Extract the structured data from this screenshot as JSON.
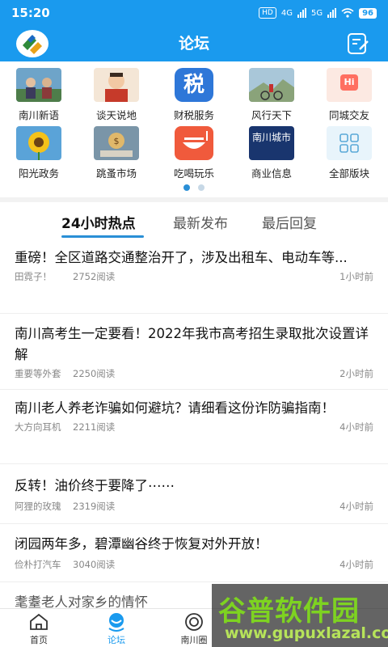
{
  "status_bar": {
    "time": "15:20",
    "hd": "HD",
    "net1": "4G",
    "net2": "5G",
    "battery": "96"
  },
  "header": {
    "title": "论坛",
    "logo_icon": "app-logo-icon",
    "compose_icon": "compose-icon"
  },
  "categories": [
    {
      "label": "南川新语",
      "icon": "news-photo"
    },
    {
      "label": "谈天说地",
      "icon": "chat-photo"
    },
    {
      "label": "财税服务",
      "icon": "tax-icon",
      "icon_text": "税"
    },
    {
      "label": "风行天下",
      "icon": "cycling-photo"
    },
    {
      "label": "同城交友",
      "icon": "map-hi-icon",
      "icon_text": "Hi"
    },
    {
      "label": "阳光政务",
      "icon": "sunflower-photo"
    },
    {
      "label": "跳蚤市场",
      "icon": "market-photo"
    },
    {
      "label": "吃喝玩乐",
      "icon": "food-icon"
    },
    {
      "label": "商业信息",
      "icon": "city-badge",
      "icon_text": "南川城市"
    },
    {
      "label": "全部版块",
      "icon": "grid-icon"
    }
  ],
  "pager": {
    "pages": 2,
    "active": 1
  },
  "tabs": [
    {
      "label": "24小时热点",
      "active": true
    },
    {
      "label": "最新发布",
      "active": false
    },
    {
      "label": "最后回复",
      "active": false
    }
  ],
  "posts": [
    {
      "title": "重磅！全区道路交通整治开了，涉及出租车、电动车等...",
      "author": "田霓子！",
      "views": "2752阅读",
      "time": "1小时前"
    },
    {
      "title": "南川高考生一定要看！2022年我市高考招生录取批次设置详解",
      "author": "重要等外套",
      "views": "2250阅读",
      "time": "2小时前"
    },
    {
      "title": "南川老人养老诈骗如何避坑？请细看这份诈防骗指南！",
      "author": "大方向耳机",
      "views": "2211阅读",
      "time": "4小时前"
    },
    {
      "title": "反转！油价终于要降了⋯⋯",
      "author": "阿狸的玫瑰",
      "views": "2319阅读",
      "time": "4小时前"
    },
    {
      "title": "闭园两年多，碧潭幽谷终于恢复对外开放！",
      "author": "俭朴打汽车",
      "views": "3040阅读",
      "time": "4小时前"
    },
    {
      "title": "耄耋老人对家乡的情怀",
      "author": "",
      "views": "",
      "time": ""
    }
  ],
  "bottom_nav": [
    {
      "label": "首页",
      "icon": "home-icon",
      "active": false
    },
    {
      "label": "论坛",
      "icon": "forum-icon",
      "active": true
    },
    {
      "label": "南川圈",
      "icon": "circle-icon",
      "active": false
    }
  ],
  "watermark": {
    "main": "谷普软件园",
    "url": "www.gupuxlazal.com"
  },
  "colors": {
    "brand": "#1a9aee",
    "accent": "#2a8fd6"
  }
}
